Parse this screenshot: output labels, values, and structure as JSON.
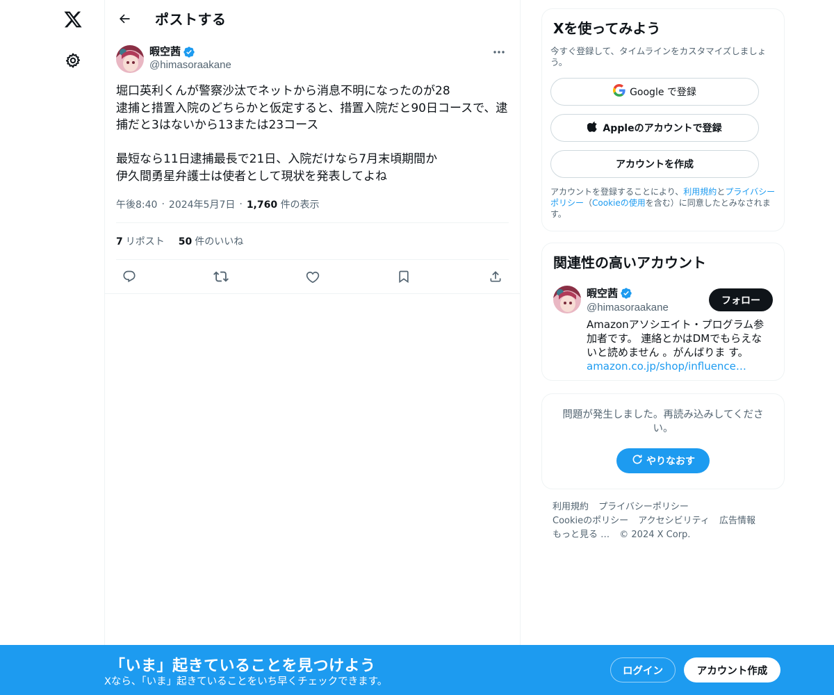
{
  "colors": {
    "accent": "#1d9bf0",
    "text": "#0f1419",
    "muted": "#536471",
    "border": "#eff3f4"
  },
  "header": {
    "title": "ポストする"
  },
  "post": {
    "author_name": "暇空茜",
    "author_handle": "@himasoraakane",
    "body": "堀口英利くんが警察沙汰でネットから消息不明になったのが28\n逮捕と措置入院のどちらかと仮定すると、措置入院だと90日コースで、逮捕だと3はないから13または23コース\n\n最短なら11日逮捕最長で21日、入院だけなら7月末頃期間か\n伊久間勇星弁護士は使者として現状を発表してよね",
    "time": "午後8:40",
    "date": "2024年5月7日",
    "views_count": "1,760",
    "views_label": "件の表示",
    "repost_count": "7",
    "repost_label": "リポスト",
    "like_count": "50",
    "like_label": "件のいいね"
  },
  "signup": {
    "title": "Xを使ってみよう",
    "subtitle": "今すぐ登録して、タイムラインをカスタマイズしましょう。",
    "google_label": "Google で登録",
    "apple_label": "Appleのアカウントで登録",
    "create_label": "アカウントを作成",
    "legal_prefix": "アカウントを登録することにより、",
    "legal_terms": "利用規約",
    "legal_and": "と",
    "legal_privacy": "プライバシーポリシー",
    "legal_paren_open": "（",
    "legal_cookie": "Cookieの使用",
    "legal_suffix": "を含む）に同意したとみなされます。"
  },
  "recommended": {
    "title": "関連性の高いアカウント",
    "name": "暇空茜",
    "handle": "@himasoraakane",
    "follow_label": "フォロー",
    "bio": "Amazonアソシエイト・プログラム参加者です。 連絡とかはDMでもらえないと読めません 。がんばりま す。",
    "bio_link": "amazon.co.jp/shop/influence…"
  },
  "error": {
    "message": "問題が発生しました。再読み込みしてください。",
    "retry_label": "やりなおす"
  },
  "footer": {
    "links": [
      "利用規約",
      "プライバシーポリシー",
      "Cookieのポリシー",
      "アクセシビリティ",
      "広告情報",
      "もっと見る …"
    ],
    "copyright": "© 2024 X Corp."
  },
  "banner": {
    "title": "「いま」起きていることを見つけよう",
    "subtitle": "Xなら、「いま」起きていることをいち早くチェックできます。",
    "login_label": "ログイン",
    "signup_label": "アカウント作成"
  },
  "icons": [
    "x-logo-icon",
    "gear-icon",
    "back-arrow-icon",
    "verified-badge-icon",
    "more-icon",
    "reply-icon",
    "repost-icon",
    "like-icon",
    "bookmark-icon",
    "share-icon",
    "google-icon",
    "apple-icon",
    "refresh-icon"
  ]
}
